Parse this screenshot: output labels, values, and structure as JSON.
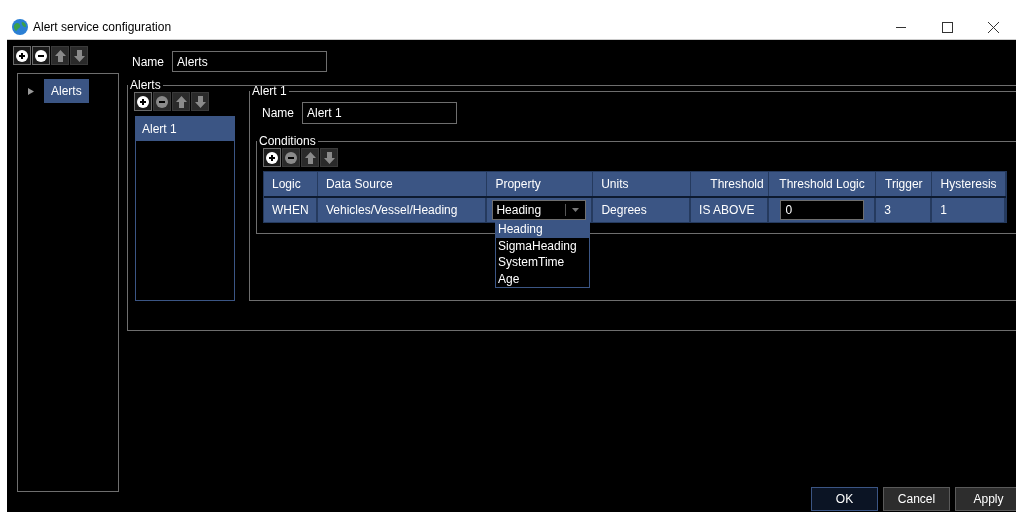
{
  "window": {
    "title": "Alert service configuration",
    "controls": [
      {
        "kind": "minimize"
      },
      {
        "kind": "maximize"
      },
      {
        "kind": "close"
      }
    ]
  },
  "tree": {
    "toolbar": [
      {
        "kind": "add",
        "disabled": false
      },
      {
        "kind": "remove",
        "disabled": false
      },
      {
        "kind": "up",
        "disabled": true
      },
      {
        "kind": "down",
        "disabled": true
      }
    ],
    "items": [
      {
        "label": "Alerts",
        "selected": true,
        "expanded": false
      }
    ]
  },
  "service": {
    "name_label": "Name",
    "name_value": "Alerts"
  },
  "alerts": {
    "title": "Alerts",
    "toolbar": [
      {
        "kind": "add",
        "disabled": false
      },
      {
        "kind": "remove",
        "disabled": true
      },
      {
        "kind": "up",
        "disabled": true
      },
      {
        "kind": "down",
        "disabled": true
      }
    ],
    "items": [
      {
        "label": "Alert 1",
        "selected": true
      }
    ]
  },
  "alert": {
    "title": "Alert 1",
    "name_label": "Name",
    "name_value": "Alert 1",
    "conditions": {
      "title": "Conditions",
      "toolbar": [
        {
          "kind": "add",
          "disabled": false
        },
        {
          "kind": "remove",
          "disabled": true
        },
        {
          "kind": "up",
          "disabled": true
        },
        {
          "kind": "down",
          "disabled": true
        }
      ],
      "columns": [
        "Logic",
        "Data Source",
        "Property",
        "Units",
        "Threshold",
        "Threshold Logic",
        "Trigger",
        "Hysteresis"
      ],
      "rows": [
        {
          "logic": "WHEN",
          "data_source": "Vehicles/Vessel/Heading",
          "property": "Heading",
          "units": "Degrees",
          "threshold": "IS ABOVE",
          "threshold_logic": "0",
          "trigger": "3",
          "hysteresis": "1"
        }
      ],
      "dropdown": {
        "options": [
          {
            "label": "Heading",
            "selected": true
          },
          {
            "label": "SigmaHeading",
            "selected": false
          },
          {
            "label": "SystemTime",
            "selected": false
          },
          {
            "label": "Age",
            "selected": false
          }
        ]
      }
    }
  },
  "buttons": [
    {
      "label": "OK",
      "focused": true
    },
    {
      "label": "Cancel",
      "focused": false
    },
    {
      "label": "Apply",
      "focused": false
    }
  ]
}
